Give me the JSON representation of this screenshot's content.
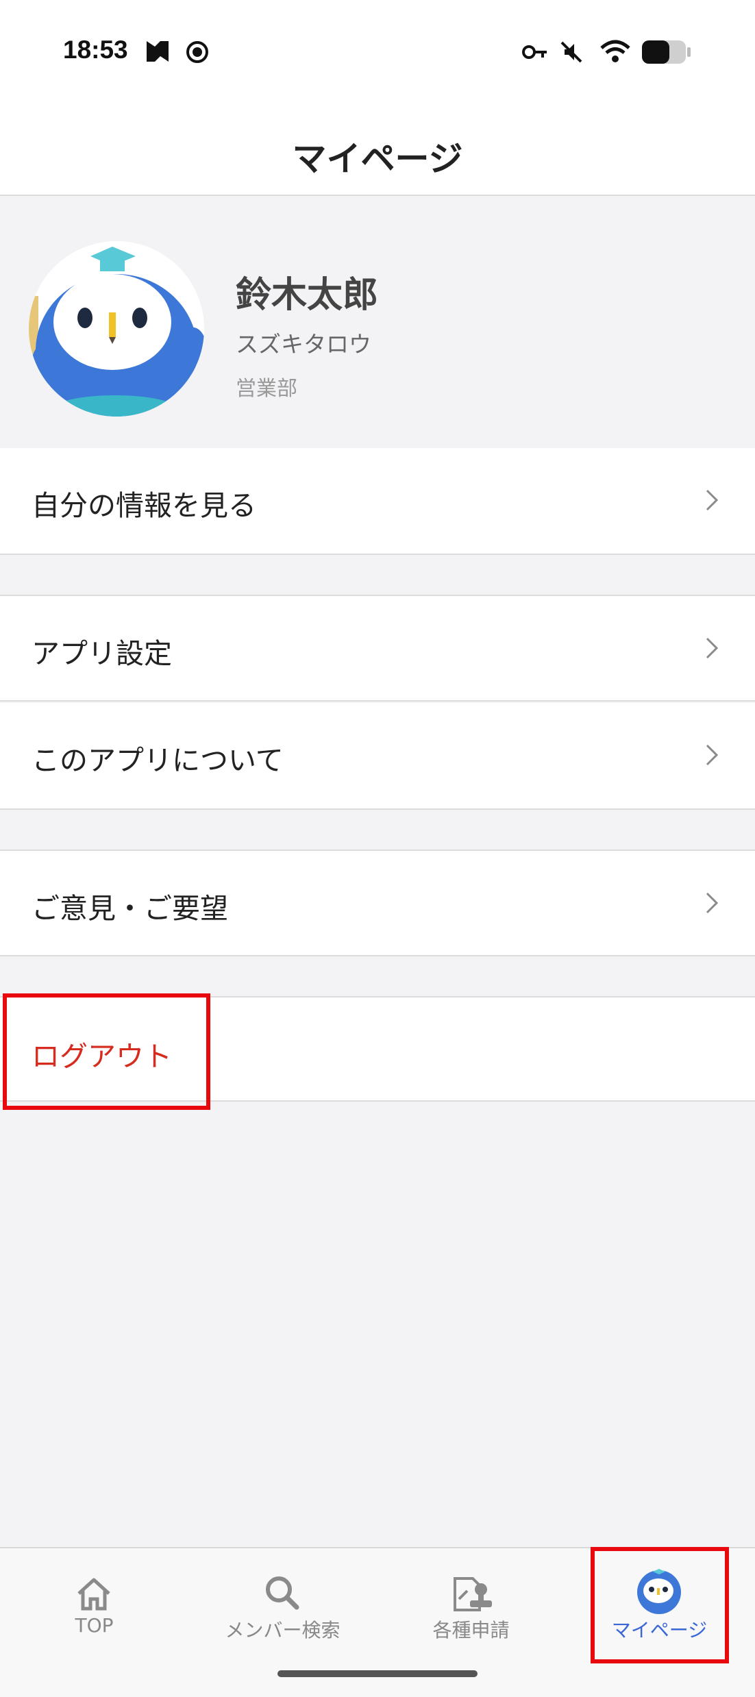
{
  "status_bar": {
    "time": "18:53",
    "icons": [
      "media-icon",
      "record-icon",
      "key-icon",
      "mute-icon",
      "wifi-icon",
      "battery-icon"
    ]
  },
  "header": {
    "title": "マイページ"
  },
  "profile": {
    "name": "鈴木太郎",
    "kana": "スズキタロウ",
    "department": "営業部",
    "avatar": "owl-mascot-avatar"
  },
  "menu": {
    "view_info": "自分の情報を見る",
    "app_settings": "アプリ設定",
    "about_app": "このアプリについて",
    "feedback": "ご意見・ご要望",
    "logout": "ログアウト"
  },
  "tabbar": {
    "tabs": [
      {
        "label": "TOP",
        "icon": "home-icon"
      },
      {
        "label": "メンバー検索",
        "icon": "search-icon"
      },
      {
        "label": "各種申請",
        "icon": "application-stamp-icon"
      },
      {
        "label": "マイページ",
        "icon": "owl-avatar-icon",
        "active": true
      }
    ]
  },
  "colors": {
    "accent": "#3a66d6",
    "logout": "#d62b1f",
    "highlight": "#e8090f",
    "avatar_blue": "#3d78d8"
  }
}
